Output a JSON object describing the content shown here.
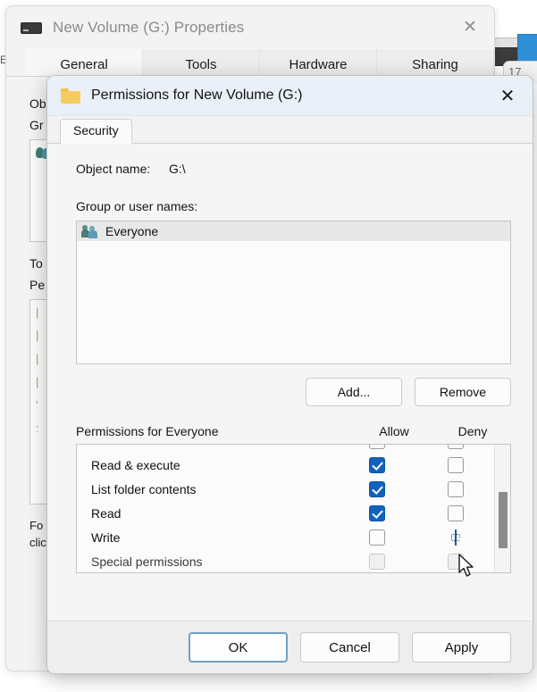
{
  "background_window": {
    "title": "New Volume (G:) Properties",
    "drive_icon": "drive-icon",
    "close_label": "✕",
    "tabs": [
      {
        "label": "General"
      },
      {
        "label": "Tools"
      },
      {
        "label": "Hardware"
      },
      {
        "label": "Sharing"
      }
    ],
    "partial_labels": {
      "object_name": "Ob",
      "group_or_user": "Gr",
      "to_change": "To",
      "permissions": "Pe",
      "for_special": "Fo",
      "click_advanced": "clic"
    },
    "edge_fragment": "E",
    "corner_fragment": "17"
  },
  "dialog": {
    "title": "Permissions for New Volume (G:)",
    "folder_icon": "folder-icon",
    "close_label": "✕",
    "tab": {
      "label": "Security"
    },
    "object_name_label": "Object name:",
    "object_name_value": "G:\\",
    "group_label": "Group or user names:",
    "users": [
      {
        "name": "Everyone",
        "icon": "people-icon",
        "selected": true
      }
    ],
    "add_label": "Add...",
    "remove_label": "Remove",
    "permissions_header": "Permissions for Everyone",
    "allow_column": "Allow",
    "deny_column": "Deny",
    "permissions": [
      {
        "name": "Read & execute",
        "allow": true,
        "deny": false,
        "disabled": false
      },
      {
        "name": "List folder contents",
        "allow": true,
        "deny": false,
        "disabled": false
      },
      {
        "name": "Read",
        "allow": true,
        "deny": false,
        "disabled": false
      },
      {
        "name": "Write",
        "allow": false,
        "deny": true,
        "disabled": false,
        "deny_focused": true
      },
      {
        "name": "Special permissions",
        "allow": false,
        "deny": false,
        "disabled": true
      }
    ],
    "footer": {
      "ok_label": "OK",
      "cancel_label": "Cancel",
      "apply_label": "Apply"
    }
  },
  "colors": {
    "checkbox_checked": "#1062c0",
    "dialog_titlebar": "#eaf0f7",
    "dialog_body": "#f5f5f5",
    "focus_border": "#6f9fc4",
    "selection": "#e8e8e8",
    "scroll_thumb": "#8c8c8c"
  }
}
